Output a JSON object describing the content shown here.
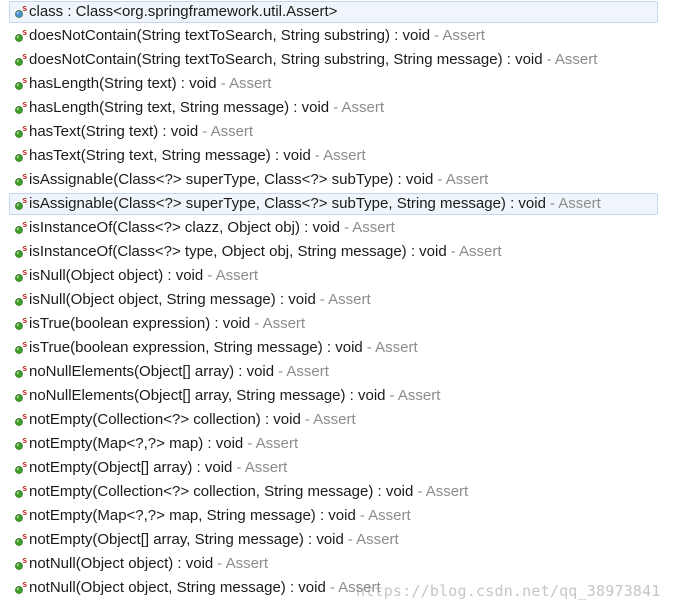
{
  "items": [
    {
      "signature": "class : Class<org.springframework.util.Assert>",
      "owner": "",
      "kind": "class-field-icon",
      "selected": true
    },
    {
      "signature": "doesNotContain(String textToSearch, String substring) : void",
      "owner": "- Assert",
      "kind": "static-method-icon",
      "selected": false
    },
    {
      "signature": "doesNotContain(String textToSearch, String substring, String message) : void",
      "owner": "- Assert",
      "kind": "static-method-icon",
      "selected": false
    },
    {
      "signature": "hasLength(String text) : void",
      "owner": "- Assert",
      "kind": "static-method-icon",
      "selected": false
    },
    {
      "signature": "hasLength(String text, String message) : void",
      "owner": "- Assert",
      "kind": "static-method-icon",
      "selected": false
    },
    {
      "signature": "hasText(String text) : void",
      "owner": "- Assert",
      "kind": "static-method-icon",
      "selected": false
    },
    {
      "signature": "hasText(String text, String message) : void",
      "owner": "- Assert",
      "kind": "static-method-icon",
      "selected": false
    },
    {
      "signature": "isAssignable(Class<?> superType, Class<?> subType) : void",
      "owner": "- Assert",
      "kind": "static-method-icon",
      "selected": false
    },
    {
      "signature": "isAssignable(Class<?> superType, Class<?> subType, String message) : void",
      "owner": "- Assert",
      "kind": "static-method-icon",
      "selected": true
    },
    {
      "signature": "isInstanceOf(Class<?> clazz, Object obj) : void",
      "owner": "- Assert",
      "kind": "static-method-icon",
      "selected": false
    },
    {
      "signature": "isInstanceOf(Class<?> type, Object obj, String message) : void",
      "owner": "- Assert",
      "kind": "static-method-icon",
      "selected": false
    },
    {
      "signature": "isNull(Object object) : void",
      "owner": "- Assert",
      "kind": "static-method-icon",
      "selected": false
    },
    {
      "signature": "isNull(Object object, String message) : void",
      "owner": "- Assert",
      "kind": "static-method-icon",
      "selected": false
    },
    {
      "signature": "isTrue(boolean expression) : void",
      "owner": "- Assert",
      "kind": "static-method-icon",
      "selected": false
    },
    {
      "signature": "isTrue(boolean expression, String message) : void",
      "owner": "- Assert",
      "kind": "static-method-icon",
      "selected": false
    },
    {
      "signature": "noNullElements(Object[] array) : void",
      "owner": "- Assert",
      "kind": "static-method-icon",
      "selected": false
    },
    {
      "signature": "noNullElements(Object[] array, String message) : void",
      "owner": "- Assert",
      "kind": "static-method-icon",
      "selected": false
    },
    {
      "signature": "notEmpty(Collection<?> collection) : void",
      "owner": "- Assert",
      "kind": "static-method-icon",
      "selected": false
    },
    {
      "signature": "notEmpty(Map<?,?> map) : void",
      "owner": "- Assert",
      "kind": "static-method-icon",
      "selected": false
    },
    {
      "signature": "notEmpty(Object[] array) : void",
      "owner": "- Assert",
      "kind": "static-method-icon",
      "selected": false
    },
    {
      "signature": "notEmpty(Collection<?> collection, String message) : void",
      "owner": "- Assert",
      "kind": "static-method-icon",
      "selected": false
    },
    {
      "signature": "notEmpty(Map<?,?> map, String message) : void",
      "owner": "- Assert",
      "kind": "static-method-icon",
      "selected": false
    },
    {
      "signature": "notEmpty(Object[] array, String message) : void",
      "owner": "- Assert",
      "kind": "static-method-icon",
      "selected": false
    },
    {
      "signature": "notNull(Object object) : void",
      "owner": "- Assert",
      "kind": "static-method-icon",
      "selected": false
    },
    {
      "signature": "notNull(Object object, String message) : void",
      "owner": "- Assert",
      "kind": "static-method-icon",
      "selected": false
    }
  ],
  "watermark": "https://blog.csdn.net/qq_38973841",
  "colors": {
    "method_dot": "#3f9a2c",
    "field_dot": "#4a8fd0",
    "static_marker": "#c0392b",
    "owner_text": "#8c8c8c",
    "selection_bg": "#f0f5fb",
    "selection_border": "#c4d7ee"
  }
}
